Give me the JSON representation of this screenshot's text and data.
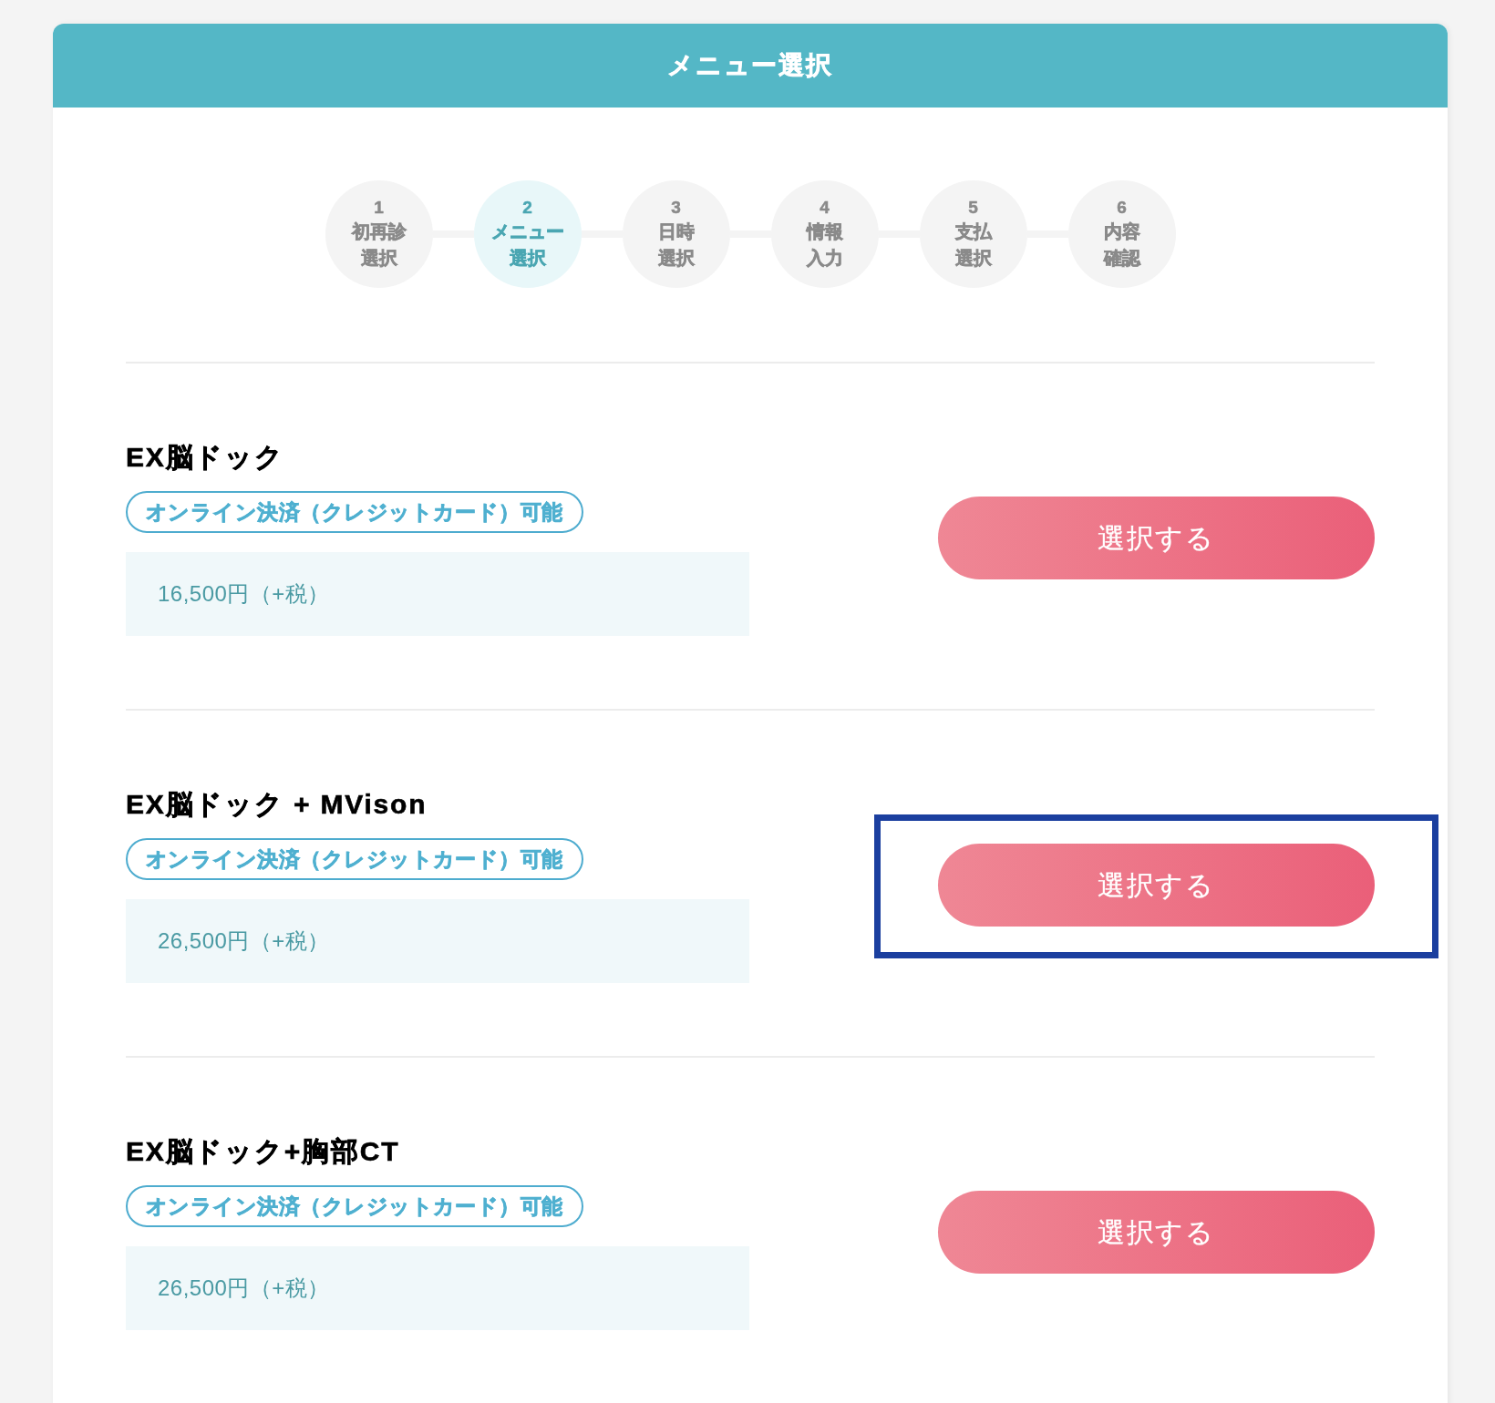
{
  "header": {
    "title": "メニュー選択"
  },
  "steps": [
    {
      "number": "1",
      "label_lines": [
        "初再診",
        "選択"
      ],
      "current": false
    },
    {
      "number": "2",
      "label_lines": [
        "メニュー",
        "選択"
      ],
      "current": true
    },
    {
      "number": "3",
      "label_lines": [
        "日時",
        "選択"
      ],
      "current": false
    },
    {
      "number": "4",
      "label_lines": [
        "情報",
        "入力"
      ],
      "current": false
    },
    {
      "number": "5",
      "label_lines": [
        "支払",
        "選択"
      ],
      "current": false
    },
    {
      "number": "6",
      "label_lines": [
        "内容",
        "確認"
      ],
      "current": false
    }
  ],
  "items": [
    {
      "title": "EX脳ドック",
      "badge": "オンライン決済（クレジットカード）可能",
      "price": "16,500円（+税）",
      "button": "選択する",
      "highlighted": false
    },
    {
      "title": "EX脳ドック + MVison",
      "badge": "オンライン決済（クレジットカード）可能",
      "price": "26,500円（+税）",
      "button": "選択する",
      "highlighted": true
    },
    {
      "title": "EX脳ドック+胸部CT",
      "badge": "オンライン決済（クレジットカード）可能",
      "price": "26,500円（+税）",
      "button": "選択する",
      "highlighted": false
    }
  ]
}
